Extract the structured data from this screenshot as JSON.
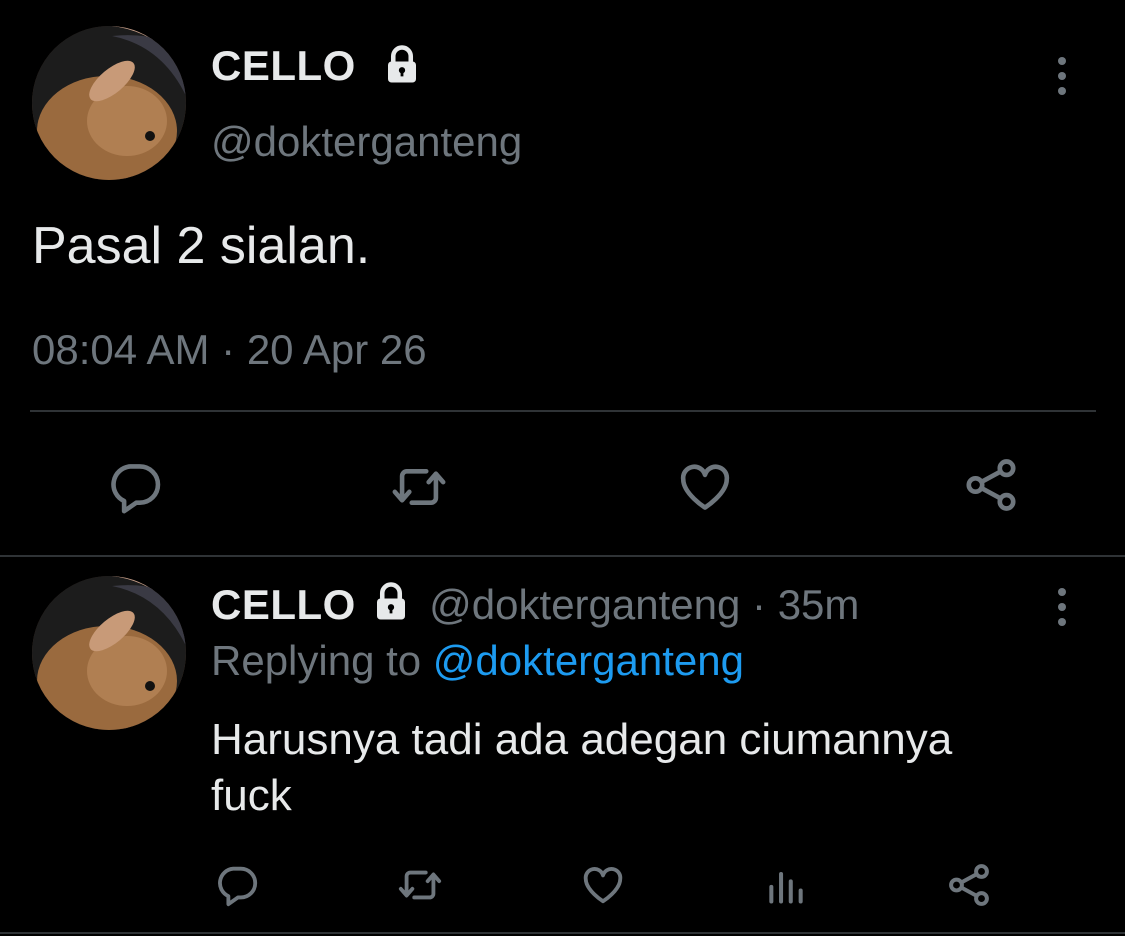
{
  "main_tweet": {
    "display_name": "CELLO",
    "handle": "@dokterganteng",
    "text": "Pasal 2 sialan.",
    "time": "08:04 AM",
    "separator": "·",
    "date": "20 Apr 26"
  },
  "reply_tweet": {
    "display_name": "CELLO",
    "handle": "@dokterganteng",
    "dot": "·",
    "age": "35m",
    "replying_prefix": "Replying to",
    "replying_handle": "@dokterganteng",
    "text_line1": "Harusnya tadi ada adegan ciumannya",
    "text_line2": "fuck"
  },
  "colors": {
    "background": "#000000",
    "muted": "#6e767d",
    "link": "#1d9bf0",
    "text": "#e7e9ea"
  },
  "icons": {
    "lock": "lock-icon",
    "more": "more-vertical-icon",
    "reply": "reply-icon",
    "retweet": "retweet-icon",
    "like": "heart-icon",
    "share": "share-icon",
    "analytics": "analytics-icon"
  }
}
